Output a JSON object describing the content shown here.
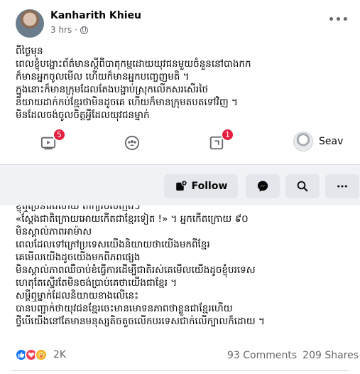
{
  "post": {
    "author": "Kanharith Khieu",
    "time": "3 hrs",
    "more_label": "•••",
    "text_top": "ពីថ្ងៃមុន\nពេលខ្ញុំបង្ហោះព័ត៌មានស្តីពីបាតុកម្មដោយយុវជនមួយចំនួននៅបាងកក\nក៏មានអ្នកចូលមើល ហើយក៏មានអ្នកបញ្ចេញមតិ ។\nក្នុងនោះក៏មានក្រុមដែលតែងបង្ហាប់ស្រុកលើកសរសើរថៃ\nនិយាយដាក់កប់ខ្មែរថាមិនដូចគេ ហើយក៏មានក្រុមតបតទៅវិញ ។\nមិនដែលចង់ចូលចិត្តអ្វីដែលយុវជនម្នាក់",
    "text_bottom": "ខ្ញុំឮច្រើនដងហើយ ពាក្យរបស់ក្មេងៗ\n«ស្តែងជាតិក្រោយអោយកើតជាខ្មែរទៀត !» ។ អ្នកកើតក្រោយ ៩០\nមិនស្គាល់ភាពអាម៉ាស\nពេលដែលទៅក្រៅប្រទេសយើងនិយាយថាយើងមកពីខ្មែរ\nគេមើលយើងដូចយើងមកពីភពផ្សេង\nមិនស្គាល់ភាពឈឺចាប់ខំធ្វើការដើម្បីជាតិរស់គេមើលយើងដូចខ្ញុំបរទេស\nហេតុតែស្ទើរតែមិនចង់ប្រាប់គេថាយើងជាខ្មែរ ។\nសម្តីឮម្នាក់ដែលនិយាយខាងលើនេះ\nបានបញ្ជាក់ថាយុវជនខ្មែរចេះមានមោទនភាពថាខ្លួនជាខ្មែរហើយ\nថ្វីបើយើងនៅតែមានមនុស្សតិចតួចលើកបរទេសជាក់លើក្បាលក៏ដោយ ។",
    "reaction_count": "2K",
    "comments": "93 Comments",
    "shares": "209 Shares"
  },
  "nav": {
    "video_badge": "5",
    "notif_badge": "1",
    "profile_name": "Seav"
  },
  "actions": {
    "follow_label": "Follow"
  },
  "icons": [
    "globe-icon",
    "video-icon",
    "groups-icon",
    "pages-icon",
    "messenger-icon",
    "search-icon",
    "more-icon",
    "follow-icon",
    "like-icon",
    "love-icon",
    "care-icon"
  ]
}
